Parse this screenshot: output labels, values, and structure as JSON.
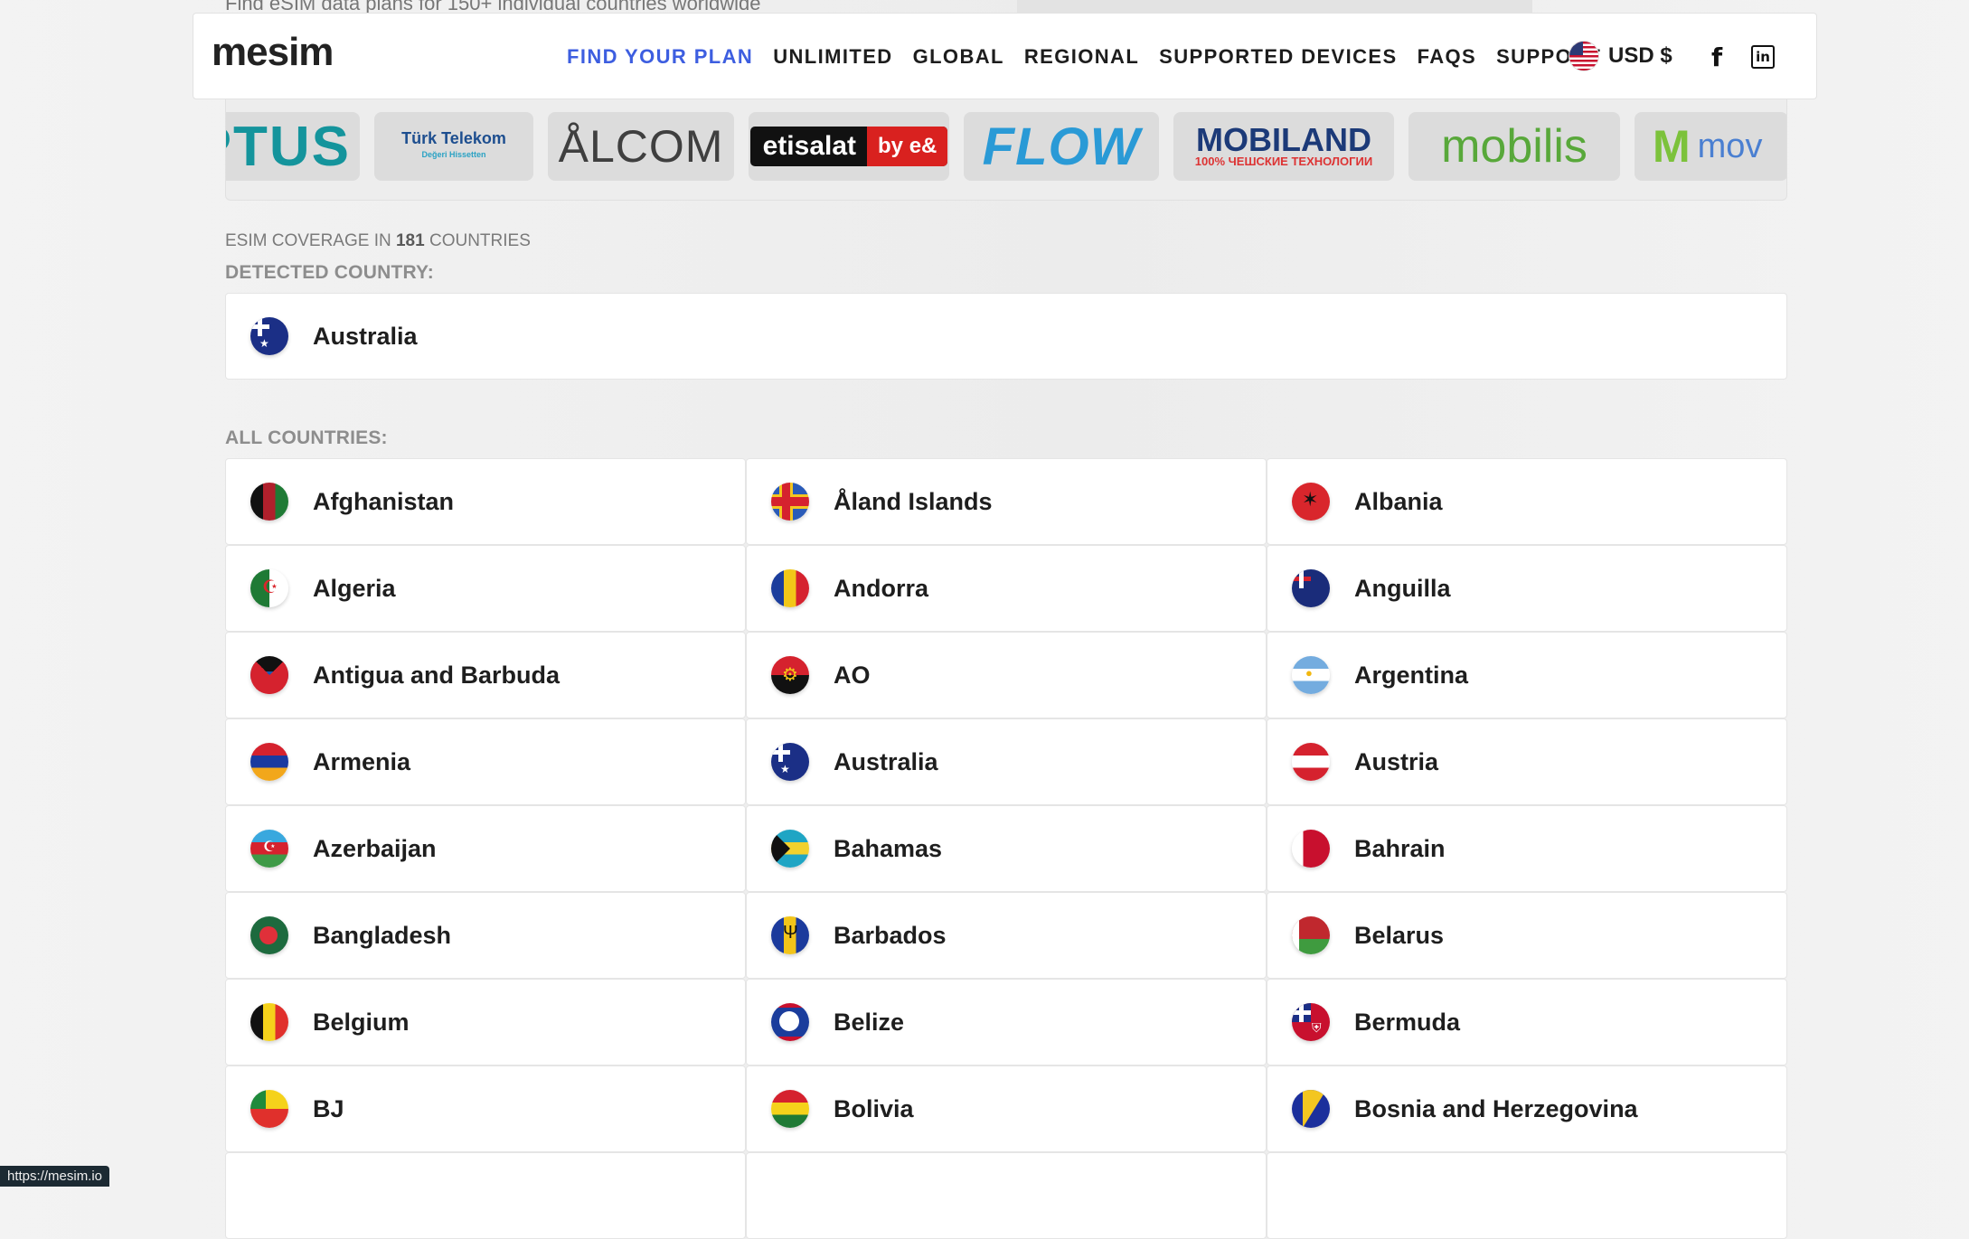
{
  "top_ghost_text": "Find eSIM data plans for 150+ individual countries worldwide",
  "header": {
    "logo": "mesim",
    "nav": [
      {
        "label": "FIND YOUR PLAN",
        "active": true
      },
      {
        "label": "UNLIMITED"
      },
      {
        "label": "GLOBAL"
      },
      {
        "label": "REGIONAL"
      },
      {
        "label": "SUPPORTED DEVICES"
      },
      {
        "label": "FAQS"
      },
      {
        "label": "SUPPORT"
      }
    ],
    "currency": "USD $",
    "social": {
      "facebook": "f",
      "linkedin": "in"
    }
  },
  "carriers": [
    "OPTUS",
    "Türk Telekom",
    "ÅLCOM",
    "etisalat",
    "FLOW",
    "MOBILAND",
    "mobilis",
    "movistar"
  ],
  "carrier_extra": {
    "turk_sub": "Değeri Hissetten",
    "etisalat_badge": "by e&",
    "mobiland_sub": "100% ЧЕШСКИЕ ТЕХНОЛОГИИ",
    "movistar_visible": "mov"
  },
  "coverage": {
    "prefix": "ESIM COVERAGE IN",
    "count": "181",
    "suffix": "COUNTRIES"
  },
  "detected_label": "DETECTED COUNTRY:",
  "detected_country": {
    "name": "Australia",
    "flag": "au"
  },
  "all_label": "ALL COUNTRIES:",
  "countries": [
    {
      "name": "Afghanistan",
      "flag": "af"
    },
    {
      "name": "Åland Islands",
      "flag": "ax"
    },
    {
      "name": "Albania",
      "flag": "al"
    },
    {
      "name": "Algeria",
      "flag": "dz"
    },
    {
      "name": "Andorra",
      "flag": "ad"
    },
    {
      "name": "Anguilla",
      "flag": "ai"
    },
    {
      "name": "Antigua and Barbuda",
      "flag": "ag"
    },
    {
      "name": "AO",
      "flag": "ao"
    },
    {
      "name": "Argentina",
      "flag": "ar"
    },
    {
      "name": "Armenia",
      "flag": "am"
    },
    {
      "name": "Australia",
      "flag": "au"
    },
    {
      "name": "Austria",
      "flag": "at"
    },
    {
      "name": "Azerbaijan",
      "flag": "az"
    },
    {
      "name": "Bahamas",
      "flag": "bs"
    },
    {
      "name": "Bahrain",
      "flag": "bh"
    },
    {
      "name": "Bangladesh",
      "flag": "bd"
    },
    {
      "name": "Barbados",
      "flag": "bb"
    },
    {
      "name": "Belarus",
      "flag": "by"
    },
    {
      "name": "Belgium",
      "flag": "be"
    },
    {
      "name": "Belize",
      "flag": "bz"
    },
    {
      "name": "Bermuda",
      "flag": "bm"
    },
    {
      "name": "BJ",
      "flag": "bj"
    },
    {
      "name": "Bolivia",
      "flag": "bo"
    },
    {
      "name": "Bosnia and Herzegovina",
      "flag": "ba"
    }
  ],
  "status_url": "https://mesim.io"
}
